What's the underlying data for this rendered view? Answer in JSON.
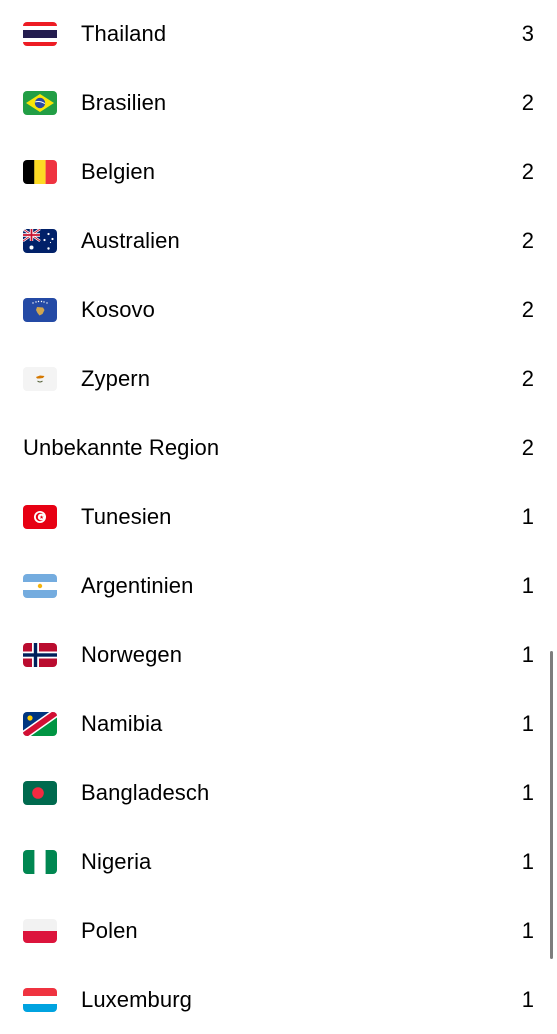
{
  "countries": [
    {
      "name": "Thailand",
      "count": "3",
      "flag_icon": "thailand-flag-icon"
    },
    {
      "name": "Brasilien",
      "count": "2",
      "flag_icon": "brazil-flag-icon"
    },
    {
      "name": "Belgien",
      "count": "2",
      "flag_icon": "belgium-flag-icon"
    },
    {
      "name": "Australien",
      "count": "2",
      "flag_icon": "australia-flag-icon"
    },
    {
      "name": "Kosovo",
      "count": "2",
      "flag_icon": "kosovo-flag-icon"
    },
    {
      "name": "Zypern",
      "count": "2",
      "flag_icon": "cyprus-flag-icon"
    },
    {
      "name": "Unbekannte Region",
      "count": "2",
      "flag_icon": null
    },
    {
      "name": "Tunesien",
      "count": "1",
      "flag_icon": "tunisia-flag-icon"
    },
    {
      "name": "Argentinien",
      "count": "1",
      "flag_icon": "argentina-flag-icon"
    },
    {
      "name": "Norwegen",
      "count": "1",
      "flag_icon": "norway-flag-icon"
    },
    {
      "name": "Namibia",
      "count": "1",
      "flag_icon": "namibia-flag-icon"
    },
    {
      "name": "Bangladesch",
      "count": "1",
      "flag_icon": "bangladesh-flag-icon"
    },
    {
      "name": "Nigeria",
      "count": "1",
      "flag_icon": "nigeria-flag-icon"
    },
    {
      "name": "Polen",
      "count": "1",
      "flag_icon": "poland-flag-icon"
    },
    {
      "name": "Luxemburg",
      "count": "1",
      "flag_icon": "luxembourg-flag-icon"
    }
  ],
  "colors": {
    "text": "#000000",
    "background": "#ffffff",
    "scrollbar": "#7d7d7d"
  }
}
